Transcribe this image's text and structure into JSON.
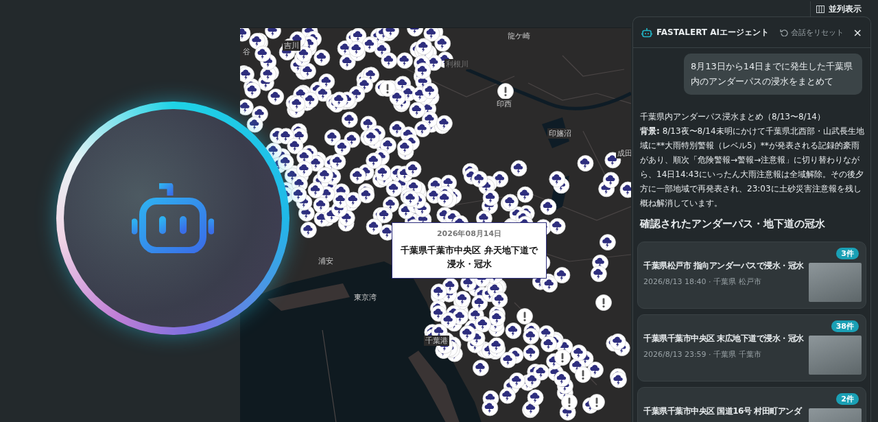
{
  "top_bar": {
    "view_toggle": {
      "label": "並列表示"
    }
  },
  "map": {
    "place_labels": [
      {
        "label": "谷"
      },
      {
        "label": "吉川"
      },
      {
        "label": "龍ケ崎"
      },
      {
        "label": "利根川"
      },
      {
        "label": "印西"
      },
      {
        "label": "印旛沼"
      },
      {
        "label": "成田"
      },
      {
        "label": "浦安"
      },
      {
        "label": "東京湾"
      },
      {
        "label": "千葉港"
      }
    ],
    "popup": {
      "date": "2026年08月14日",
      "title": "千葉県千葉市中央区 弁天地下道で浸水・冠水"
    }
  },
  "agent_panel": {
    "title": "FASTALERT AIエージェント",
    "reset_label": "会話をリセット",
    "close_label": "×",
    "user_message": "8月13日から14日までに発生した千葉県内のアンダーパスの浸水をまとめて",
    "answer": {
      "title": "千葉県内アンダーパス浸水まとめ（8/13〜8/14）",
      "background_label": "背景:",
      "background_text": " 8/13夜〜8/14未明にかけて千葉県北西部・山武長生地域に**大雨特別警報（レベル5）**が発表される記録的豪雨があり、順次「危険警報→警報→注意報」に切り替わりながら、14日14:43にいったん大雨注意報は全域解除。その後夕方に一部地域で再発表され、23:03に土砂災害注意報を残し概ね解消しています。",
      "section_heading": "確認されたアンダーパス・地下道の冠水"
    },
    "results": [
      {
        "title": "千葉県松戸市 指向アンダーパスで浸水・冠水",
        "meta": "2026/8/13 18:40 · 千葉県 松戸市",
        "count": "3件"
      },
      {
        "title": "千葉県千葉市中央区 末広地下道で浸水・冠水",
        "meta": "2026/8/13 23:59 · 千葉県 千葉市",
        "count": "38件"
      },
      {
        "title": "千葉県千葉市中央区 国道16号 村田町アンダ",
        "count": "2件"
      }
    ]
  }
}
